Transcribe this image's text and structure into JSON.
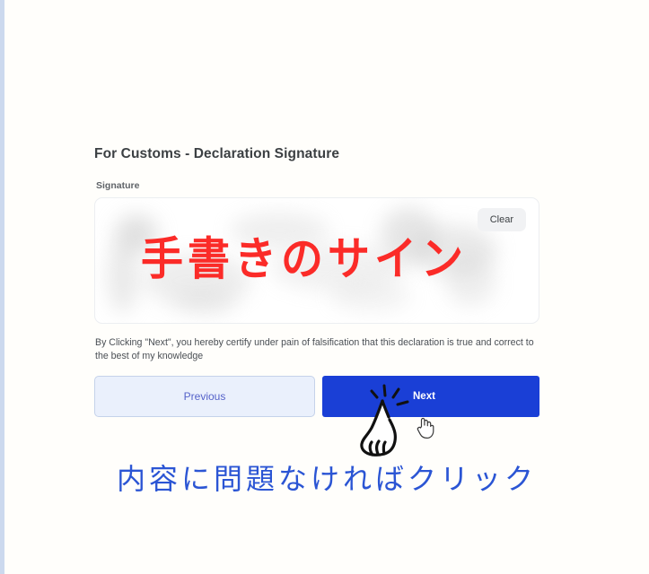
{
  "page": {
    "title": "For Customs - Declaration Signature",
    "background_color": "#fffefb",
    "edge_strip_color": "#ccd9ee"
  },
  "signature_section": {
    "label": "Signature",
    "clear_label": "Clear",
    "pad_placeholder": "",
    "annotation_text": "手書きのサイン",
    "annotation_color": "#fb2b28",
    "content_state": "blurred handwritten signature"
  },
  "disclaimer": {
    "text": "By Clicking \"Next\", you hereby certify under pain of falsification that this declaration is true and correct to the best of my knowledge"
  },
  "actions": {
    "previous_label": "Previous",
    "next_label": "Next",
    "previous_color": "#eaf0fc",
    "next_color": "#1a3fd6"
  },
  "annotations": {
    "instruction_text": "内容に問題なければクリック",
    "instruction_color": "#2b55d4",
    "tap_icon": "pointing-hand-tap-icon",
    "cursor_icon": "pointer-hand-cursor-icon"
  }
}
